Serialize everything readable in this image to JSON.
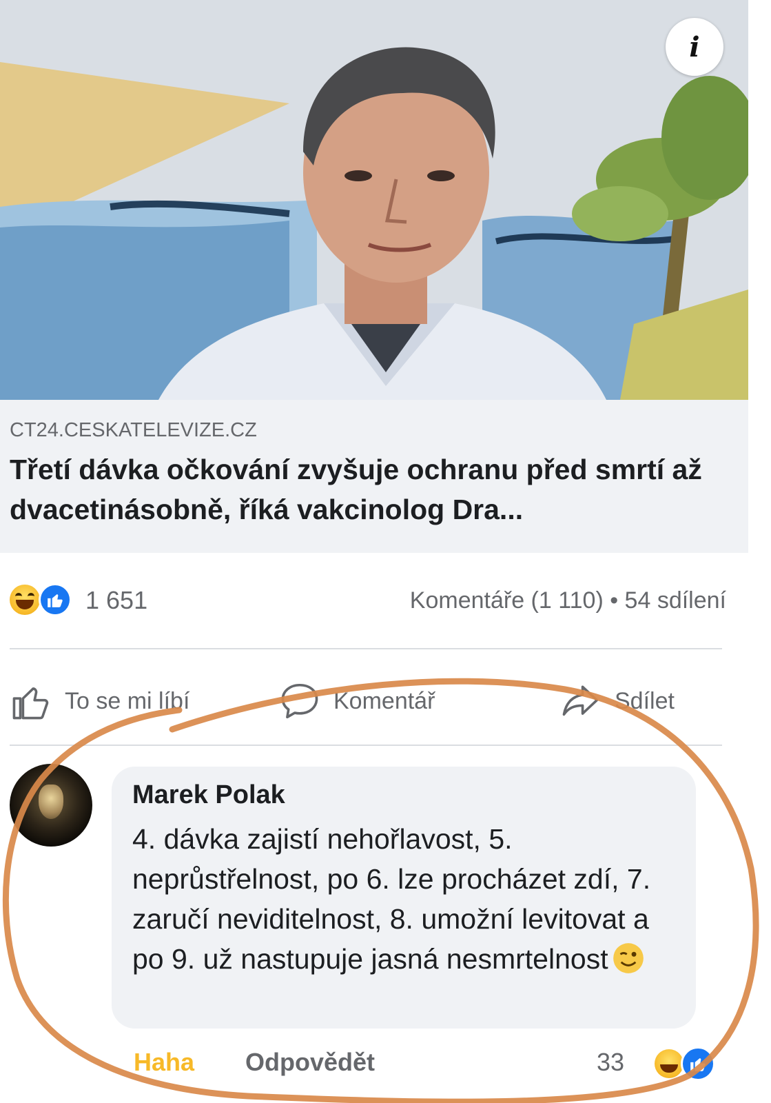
{
  "link_preview": {
    "domain": "CT24.CESKATELEVIZE.CZ",
    "title": "Třetí dávka očkování zvyšuje ochranu před smrtí až dvacetinásobně, říká vakcinolog Dra..."
  },
  "stats": {
    "reaction_count": "1 651",
    "comments_shares": "Komentáře (1 110) • 54 sdílení"
  },
  "actions": {
    "like_label": "To se mi líbí",
    "comment_label": "Komentář",
    "share_label": "Sdílet"
  },
  "comment": {
    "author": "Marek Polak",
    "text": "4. dávka zajistí nehořlavost, 5. neprůstřelnost, po 6. lze procházet zdí, 7. zaručí neviditelnost, 8. umožní levitovat a po 9. už nastupuje jasná nesmrtelnost",
    "haha_label": "Haha",
    "reply_label": "Odpovědět",
    "reaction_count": "33"
  },
  "colors": {
    "accent_blue": "#1877f2",
    "haha_yellow": "#f7b928",
    "annotation_orange": "#d9894a",
    "muted_text": "#65676b"
  },
  "icons": [
    "info-icon",
    "haha-reaction-icon",
    "like-reaction-icon",
    "thumbs-up-icon",
    "comment-icon",
    "share-icon",
    "wink-emoji-icon"
  ]
}
